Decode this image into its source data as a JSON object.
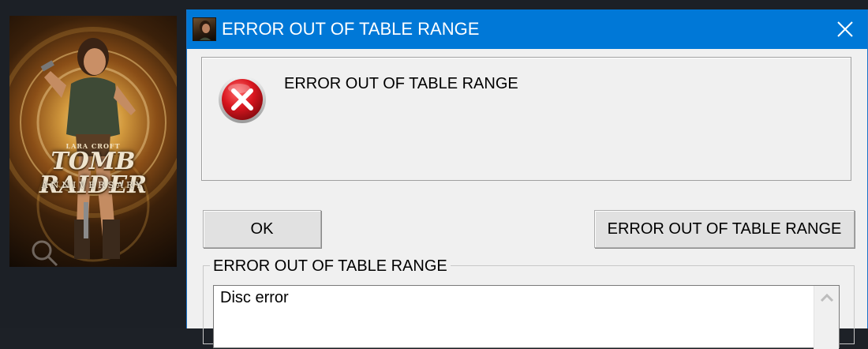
{
  "background": {
    "cover": {
      "logo_small": "LARA CROFT",
      "logo_main": "TOMB RAIDER",
      "logo_sub": "ANNIVERSARY",
      "search_icon": "search-icon"
    }
  },
  "dialog": {
    "title": "ERROR OUT OF TABLE RANGE",
    "title_icon": "lara-croft-app-icon",
    "close_icon": "close-icon",
    "message": "ERROR OUT OF TABLE RANGE",
    "message_icon": "error-icon",
    "buttons": {
      "ok": "OK",
      "details": "ERROR OUT OF TABLE RANGE"
    },
    "details_group": {
      "legend": "ERROR OUT OF TABLE RANGE",
      "text": "Disc error",
      "scroll_up_icon": "chevron-up-icon"
    }
  },
  "colors": {
    "titlebar": "#0078d7",
    "dialog_bg": "#f0f0f0",
    "error_red": "#c8101a"
  }
}
